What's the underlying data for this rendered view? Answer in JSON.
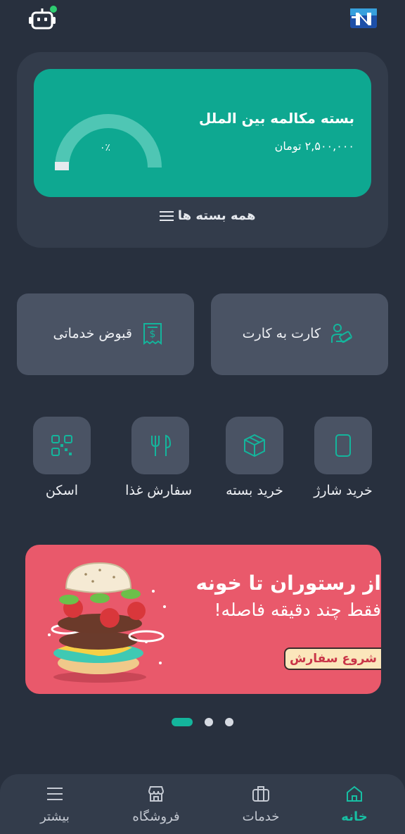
{
  "package": {
    "title": "بسته مکالمه بین الملل",
    "price": "۲,۵۰۰,۰۰۰ تومان",
    "usage_percent_label": "۰٪",
    "usage_fraction": 0,
    "all_packages_label": "همه بسته ها"
  },
  "actions": {
    "card_to_card": "کارت به کارت",
    "bills": "قبوض خدماتی"
  },
  "services": [
    {
      "label": "خرید شارژ",
      "icon": "phone-icon"
    },
    {
      "label": "خرید بسته",
      "icon": "box-icon"
    },
    {
      "label": "سفارش غذا",
      "icon": "fork-knife-icon"
    },
    {
      "label": "اسکن",
      "icon": "qr-scan-icon"
    }
  ],
  "banner": {
    "headline": "از رستوران تا خونه",
    "subline": "فقط چند دقیقه فاصله!",
    "cta": "شروع سفارش"
  },
  "carousel": {
    "count": 3,
    "active_index": 0
  },
  "nav": [
    {
      "label": "خانه",
      "icon": "home-icon",
      "active": true
    },
    {
      "label": "خدمات",
      "icon": "briefcase-icon",
      "active": false
    },
    {
      "label": "فروشگاه",
      "icon": "store-icon",
      "active": false
    },
    {
      "label": "بیشتر",
      "icon": "menu-icon",
      "active": false
    }
  ],
  "colors": {
    "background": "#28303e",
    "card": "#333c4b",
    "accent": "#0ea891",
    "banner": "#e9596b",
    "status_online": "#2ecc71"
  }
}
